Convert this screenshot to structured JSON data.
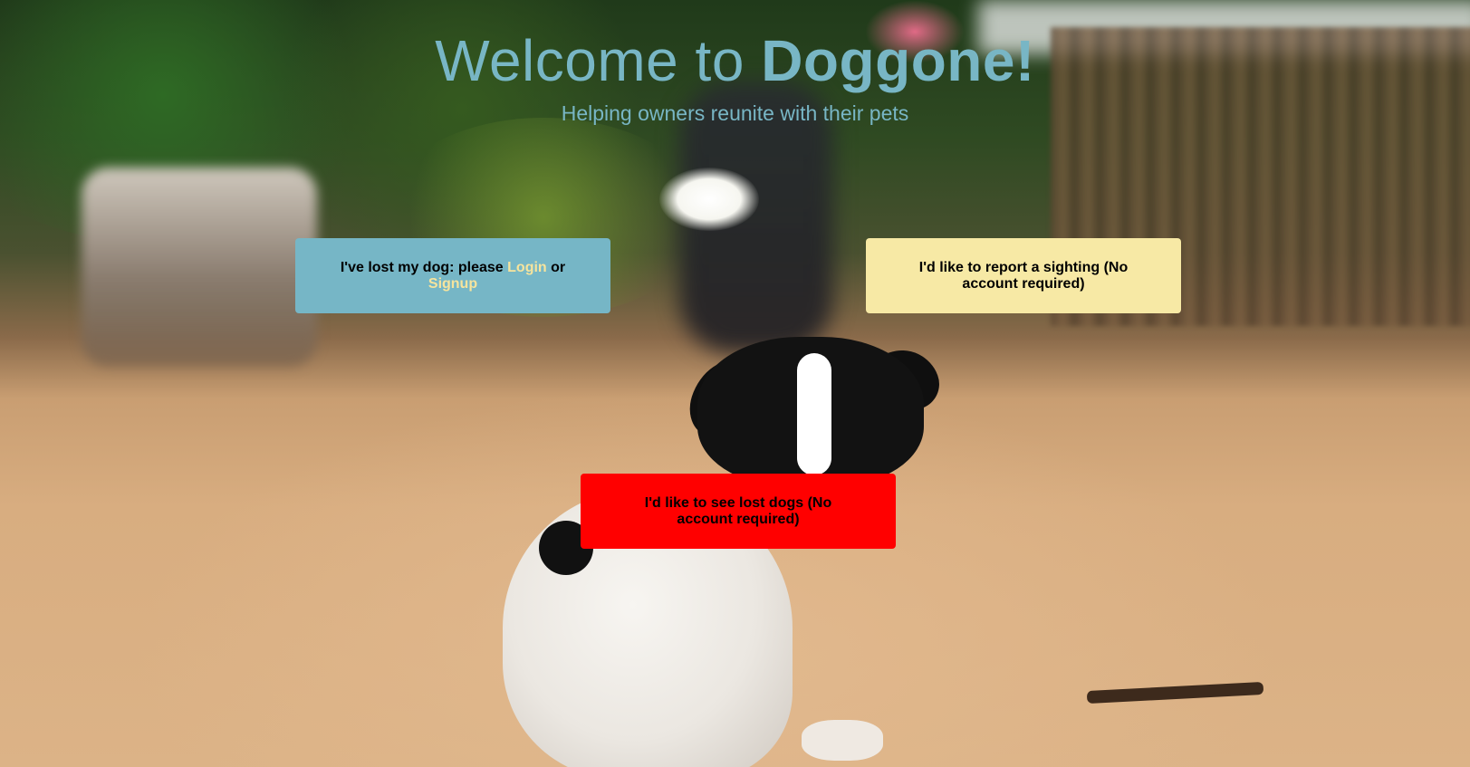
{
  "header": {
    "title_prefix": "Welcome to ",
    "title_brand": "Doggone!",
    "subtitle": "Helping owners reunite with their pets"
  },
  "cards": {
    "lost": {
      "text_before": "I've lost my dog: please ",
      "login_label": "Login",
      "text_between": " or ",
      "signup_label": "Signup"
    },
    "sighting": {
      "label": "I'd like to report a sighting (No account required)"
    },
    "see_lost": {
      "label": "I'd like to see lost dogs (No account required)"
    }
  },
  "colors": {
    "accent": "#78b6c5",
    "lost_card": "#76b6c6",
    "sighting_card": "#f7e9a5",
    "see_card": "#ff0000",
    "link": "#f6e49d"
  }
}
